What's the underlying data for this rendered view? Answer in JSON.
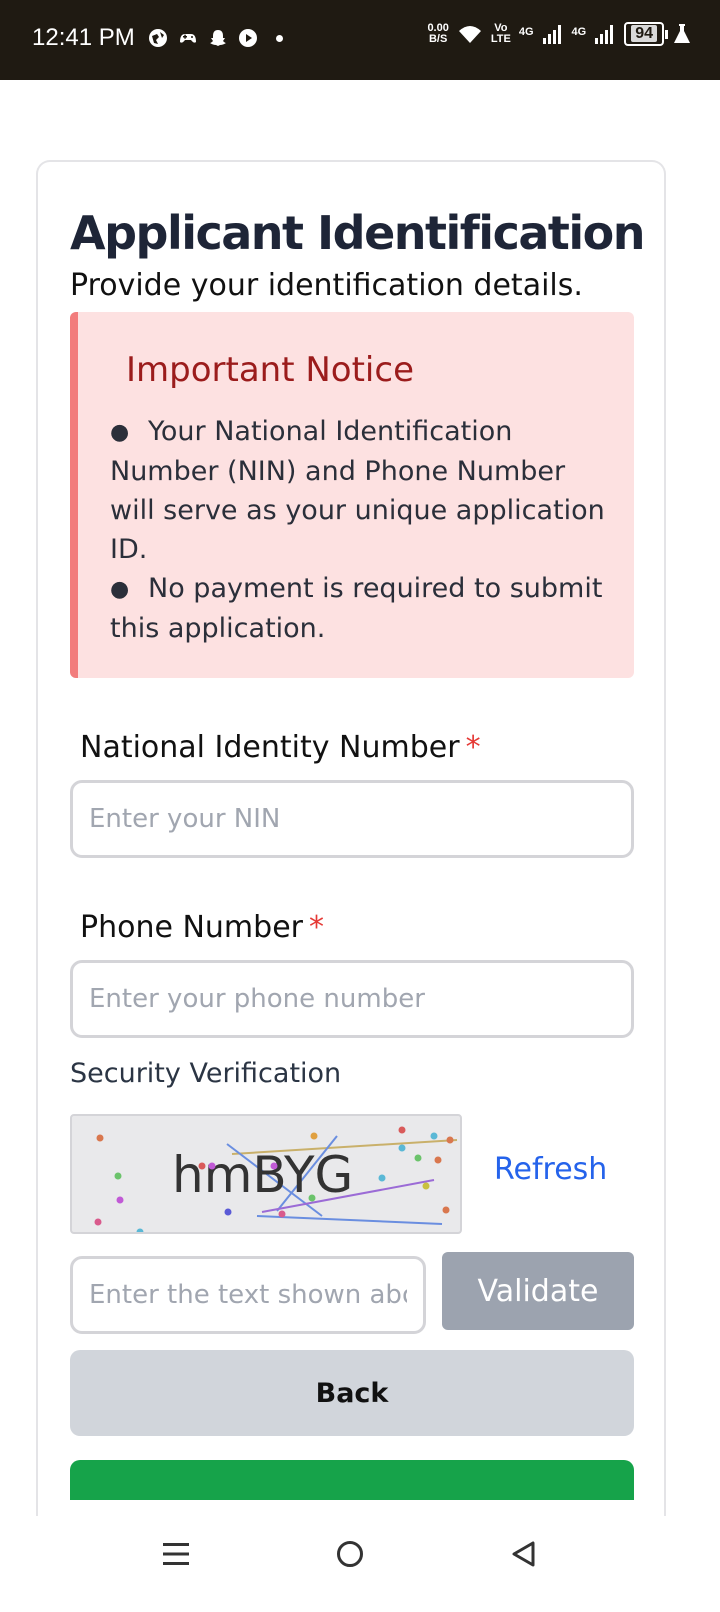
{
  "status_bar": {
    "time": "12:41 PM",
    "net_speed_value": "0.00",
    "net_speed_unit": "B/S",
    "volte_top": "Vo",
    "volte_bottom": "LTE",
    "signal1_label": "4G",
    "signal2_label": "4G",
    "battery": "94"
  },
  "page": {
    "title": "Applicant Identification",
    "subtitle": "Provide your identification details."
  },
  "notice": {
    "title": "Important Notice",
    "items": [
      "Your National Identification Number (NIN) and Phone Number will serve as your unique application ID.",
      "No payment is required to submit this application."
    ]
  },
  "form": {
    "nin_label": "National Identity Number",
    "nin_placeholder": "Enter your NIN",
    "phone_label": "Phone Number",
    "phone_placeholder": "Enter your phone number",
    "required_marker": "*",
    "security_label": "Security Verification",
    "captcha_text": "hmBYG",
    "refresh_label": "Refresh",
    "captcha_placeholder": "Enter the text shown above",
    "validate_label": "Validate",
    "back_label": "Back"
  },
  "colors": {
    "submit_button": "#16a34a",
    "notice_border": "#f27c7c",
    "notice_bg": "#fde1e1",
    "link": "#2563eb"
  },
  "nav": {
    "menu_icon": "menu-icon",
    "home_icon": "home-circle-icon",
    "back_icon": "back-triangle-icon"
  }
}
